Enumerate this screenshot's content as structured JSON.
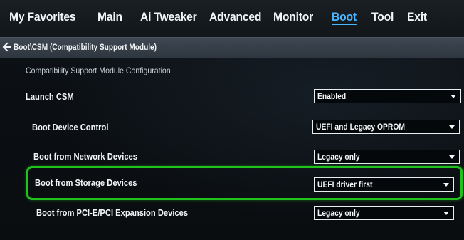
{
  "tabs": [
    {
      "label": "My Favorites",
      "active": false
    },
    {
      "label": "Main",
      "active": false
    },
    {
      "label": "Ai Tweaker",
      "active": false
    },
    {
      "label": "Advanced",
      "active": false
    },
    {
      "label": "Monitor",
      "active": false
    },
    {
      "label": "Boot",
      "active": true
    },
    {
      "label": "Tool",
      "active": false
    },
    {
      "label": "Exit",
      "active": false
    }
  ],
  "breadcrumb": {
    "text": "Boot\\CSM (Compatibility Support Module)",
    "back_icon": "back-arrow-icon"
  },
  "section": {
    "title": "Compatibility Support Module Configuration"
  },
  "settings": [
    {
      "label": "Launch CSM",
      "value": "Enabled"
    },
    {
      "label": "Boot Device Control",
      "value": "UEFI and Legacy OPROM"
    },
    {
      "label": "Boot from Network Devices",
      "value": "Legacy only"
    },
    {
      "label": "Boot from Storage Devices",
      "value": "UEFI driver first",
      "highlighted": true
    },
    {
      "label": "Boot from PCI-E/PCI Expansion Devices",
      "value": "Legacy only"
    }
  ],
  "colors": {
    "active_tab": "#49b6ff",
    "highlight": "#22c21e",
    "breadcrumb_bar": "#3f4853"
  }
}
